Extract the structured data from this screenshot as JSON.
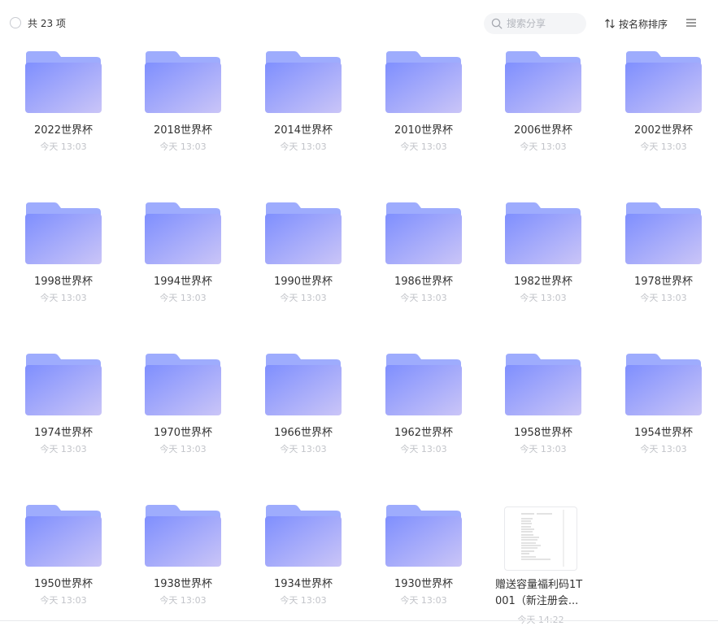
{
  "header": {
    "count_label": "共 23 项",
    "search_placeholder": "搜索分享",
    "sort_label": "按名称排序"
  },
  "colors": {
    "folder_front_start": "#7f8ffe",
    "folder_front_end": "#cac5f7",
    "folder_back": "#9eacfd"
  },
  "items": [
    {
      "name": "2022世界杯",
      "time": "今天 13:03",
      "type": "folder-icon"
    },
    {
      "name": "2018世界杯",
      "time": "今天 13:03",
      "type": "folder-icon"
    },
    {
      "name": "2014世界杯",
      "time": "今天 13:03",
      "type": "folder-icon"
    },
    {
      "name": "2010世界杯",
      "time": "今天 13:03",
      "type": "folder-icon"
    },
    {
      "name": "2006世界杯",
      "time": "今天 13:03",
      "type": "folder-icon"
    },
    {
      "name": "2002世界杯",
      "time": "今天 13:03",
      "type": "folder-icon"
    },
    {
      "name": "1998世界杯",
      "time": "今天 13:03",
      "type": "folder-icon"
    },
    {
      "name": "1994世界杯",
      "time": "今天 13:03",
      "type": "folder-icon"
    },
    {
      "name": "1990世界杯",
      "time": "今天 13:03",
      "type": "folder-icon"
    },
    {
      "name": "1986世界杯",
      "time": "今天 13:03",
      "type": "folder-icon"
    },
    {
      "name": "1982世界杯",
      "time": "今天 13:03",
      "type": "folder-icon"
    },
    {
      "name": "1978世界杯",
      "time": "今天 13:03",
      "type": "folder-icon"
    },
    {
      "name": "1974世界杯",
      "time": "今天 13:03",
      "type": "folder-icon"
    },
    {
      "name": "1970世界杯",
      "time": "今天 13:03",
      "type": "folder-icon"
    },
    {
      "name": "1966世界杯",
      "time": "今天 13:03",
      "type": "folder-icon"
    },
    {
      "name": "1962世界杯",
      "time": "今天 13:03",
      "type": "folder-icon"
    },
    {
      "name": "1958世界杯",
      "time": "今天 13:03",
      "type": "folder-icon"
    },
    {
      "name": "1954世界杯",
      "time": "今天 13:03",
      "type": "folder-icon"
    },
    {
      "name": "1950世界杯",
      "time": "今天 13:03",
      "type": "folder-icon"
    },
    {
      "name": "1938世界杯",
      "time": "今天 13:03",
      "type": "folder-icon"
    },
    {
      "name": "1934世界杯",
      "time": "今天 13:03",
      "type": "folder-icon"
    },
    {
      "name": "1930世界杯",
      "time": "今天 13:03",
      "type": "folder-icon"
    },
    {
      "name": "赠送容量福利码1T001（新注册会...",
      "time": "今天 14:22",
      "type": "document-icon"
    }
  ]
}
